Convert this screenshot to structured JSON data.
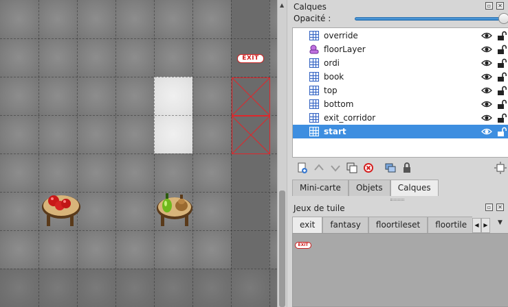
{
  "map": {
    "exit_sign_text": "EXIT"
  },
  "layers_panel": {
    "title": "Calques",
    "opacity_label": "Opacité :",
    "opacity_value": 1.0,
    "layers": [
      {
        "name": "override",
        "type": "tile-layer-icon",
        "visible": true,
        "locked": false,
        "selected": false
      },
      {
        "name": "floorLayer",
        "type": "object-layer-icon",
        "visible": true,
        "locked": false,
        "selected": false
      },
      {
        "name": "ordi",
        "type": "tile-layer-icon",
        "visible": true,
        "locked": false,
        "selected": false
      },
      {
        "name": "book",
        "type": "tile-layer-icon",
        "visible": true,
        "locked": false,
        "selected": false
      },
      {
        "name": "top",
        "type": "tile-layer-icon",
        "visible": true,
        "locked": false,
        "selected": false
      },
      {
        "name": "bottom",
        "type": "tile-layer-icon",
        "visible": true,
        "locked": false,
        "selected": false
      },
      {
        "name": "exit_corridor",
        "type": "tile-layer-icon",
        "visible": true,
        "locked": false,
        "selected": false
      },
      {
        "name": "start",
        "type": "tile-layer-icon",
        "visible": true,
        "locked": false,
        "selected": true
      }
    ],
    "toolbar_icons": [
      "add-layer-icon",
      "raise-layer-icon",
      "lower-layer-icon",
      "duplicate-layer-icon",
      "remove-layer-icon",
      "merge-layer-icon",
      "lock-icon",
      "highlight-layer-icon"
    ],
    "tabs": [
      "Mini-carte",
      "Objets",
      "Calques"
    ],
    "active_tab": "Calques"
  },
  "tilesets_panel": {
    "title": "Jeux de tuile",
    "tabs": [
      "exit",
      "fantasy",
      "floortileset",
      "floortile"
    ],
    "active_tab": "exit",
    "tile_text": "EXIT"
  },
  "colors": {
    "selection": "#3d8ee0",
    "exit_red": "#d01c1c",
    "panel_bg": "#d6d6d6",
    "map_bg": "#7a7a7a"
  }
}
